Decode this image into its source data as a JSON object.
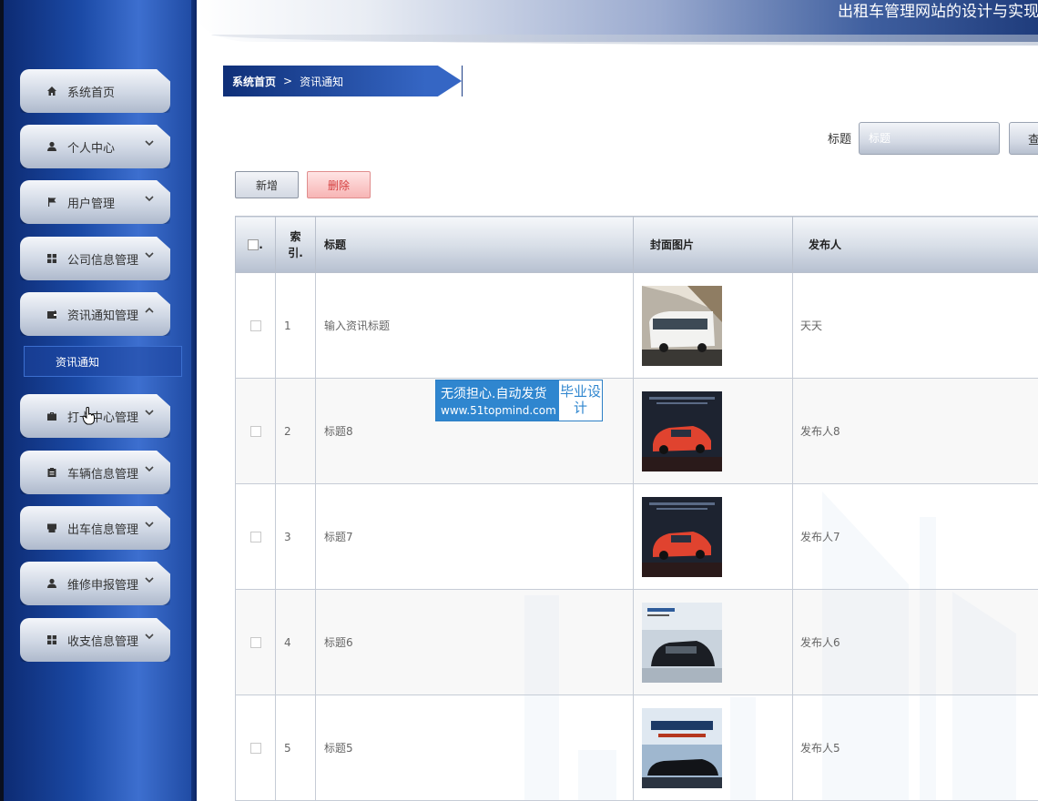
{
  "header": {
    "site_title": "出租车管理网站的设计与实现"
  },
  "sidebar": {
    "items": [
      {
        "label": "系统首页",
        "icon": "home-icon",
        "has_chevron": false
      },
      {
        "label": "个人中心",
        "icon": "user-icon",
        "has_chevron": true
      },
      {
        "label": "用户管理",
        "icon": "flag-icon",
        "has_chevron": true
      },
      {
        "label": "公司信息管理",
        "icon": "grid-icon",
        "has_chevron": true
      },
      {
        "label": "资讯通知管理",
        "icon": "wallet-icon",
        "has_chevron": true,
        "expanded": true
      },
      {
        "label": "打卡中心管理",
        "icon": "briefcase-icon",
        "has_chevron": true
      },
      {
        "label": "车辆信息管理",
        "icon": "clipboard-icon",
        "has_chevron": true
      },
      {
        "label": "出车信息管理",
        "icon": "printer-icon",
        "has_chevron": true
      },
      {
        "label": "维修申报管理",
        "icon": "user-icon",
        "has_chevron": true
      },
      {
        "label": "收支信息管理",
        "icon": "grid-icon",
        "has_chevron": true
      }
    ],
    "subitem": "资讯通知"
  },
  "breadcrumb": {
    "home": "系统首页",
    "separator": ">",
    "current": "资讯通知"
  },
  "search": {
    "label": "标题",
    "placeholder": "标题",
    "button": "查询"
  },
  "actions": {
    "add": "新增",
    "delete": "删除"
  },
  "table": {
    "headers": {
      "index": [
        "索",
        "引."
      ],
      "title": "标题",
      "cover": "封面图片",
      "publisher": "发布人"
    },
    "rows": [
      {
        "index": "1",
        "title": "输入资讯标题",
        "cover": "bus-photo",
        "publisher": "天天"
      },
      {
        "index": "2",
        "title": "标题8",
        "cover": "red-suv-poster",
        "publisher": "发布人8"
      },
      {
        "index": "3",
        "title": "标题7",
        "cover": "red-suv-poster",
        "publisher": "发布人7"
      },
      {
        "index": "4",
        "title": "标题6",
        "cover": "black-suv-poster",
        "publisher": "发布人6"
      },
      {
        "index": "5",
        "title": "标题5",
        "cover": "luxury-car-poster",
        "publisher": "发布人5"
      }
    ]
  },
  "badge": {
    "line1": "无须担心.自动发货",
    "line2": "www.51topmind.com",
    "right": "毕业设计"
  },
  "colors": {
    "sidebar": "#1b4aa6",
    "breadcrumb": "#0f2f78",
    "delete": "#d43c3c",
    "badge": "#2f86cf"
  }
}
